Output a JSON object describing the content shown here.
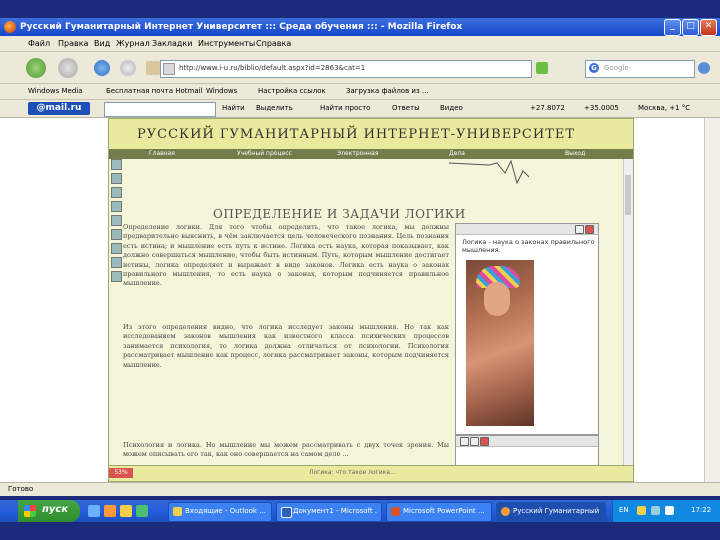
{
  "window": {
    "title": "Русский Гуманитарный Интернет Университет ::: Среда обучения ::: - Mozilla Firefox",
    "min_label": "_",
    "max_label": "□",
    "close_label": "✕"
  },
  "menu": [
    "Файл",
    "Правка",
    "Вид",
    "Журнал",
    "Закладки",
    "Инструменты",
    "Справка"
  ],
  "nav": {
    "url": "http://www.i-u.ru/biblio/default.aspx?id=2863&cat=1",
    "search_placeholder": "Google",
    "search_engine_icon": "G"
  },
  "bookmarks": [
    "Windows Media",
    "Бесплатная почта Hotmail",
    "Windows",
    "Настройка ссылок",
    "Загрузка файлов из ..."
  ],
  "mail_toolbar": {
    "logo": "@mail.ru",
    "find_label": "Найти",
    "items": [
      "Выделить",
      "Найти просто",
      "Ответы",
      "Видео",
      "+27.8072",
      "+35.0005",
      "Москва, +1 °С"
    ]
  },
  "page": {
    "university": "РУССКИЙ ГУМАНИТАРНЫЙ ИНТЕРНЕТ-УНИВЕРСИТЕТ",
    "topnav": [
      "Главная",
      "Учебный процесс",
      "Электронная",
      "Дела",
      "Выход"
    ],
    "doc_title": "ОПРЕДЕЛЕНИЕ И ЗАДАЧИ ЛОГИКИ",
    "para1": "Определение логики. Для того чтобы определить, что такое логика, мы должны предварительно выяснить, в чём заключается цель человеческого познания. Цель познания есть истина; и мышление есть путь к истине. Логика есть наука, которая показывает, как должно совершаться мышление, чтобы быть истинным. Путь, которым мышление достигает истины, логика определяет и выражает в виде законов. Логика есть наука о законах правильного мышления, то есть наука о законах, которым подчиняется правильное мышление.",
    "para2": "Из этого определения видно, что логика исследует законы мышления. Но так как исследованием законов мышления как известного класса психических процессов занимается психология, то логика должна отличаться от психологии. Психология рассматривает мышление как процесс, логика рассматривает законы, которым подчиняется мышление.",
    "para3": "Психология и логика. Но мышление мы можем рассматривать с двух точек зрения. Мы можем описывать его так, как оно совершается на самом деле ...",
    "side_caption": "Логика - наука о законах правильного мышления.",
    "zoom": "53%",
    "bottom_line": "Логика: что такое логика..."
  },
  "statusbar": {
    "text": "Готово"
  },
  "taskbar": {
    "start": "пуск",
    "buttons": [
      "Входящие - Outlook ...",
      "Документ1 - Microsoft ...",
      "Microsoft PowerPoint ...",
      "Русский Гуманитарный ..."
    ],
    "lang": "EN",
    "clock": "17:22"
  },
  "colors": {
    "page_bg": "#f4f5d9",
    "header_bg": "#e9ea9e",
    "topnav_bg": "#737c4b",
    "taskbar": "#245edb",
    "titlebar": "#1646c8"
  }
}
